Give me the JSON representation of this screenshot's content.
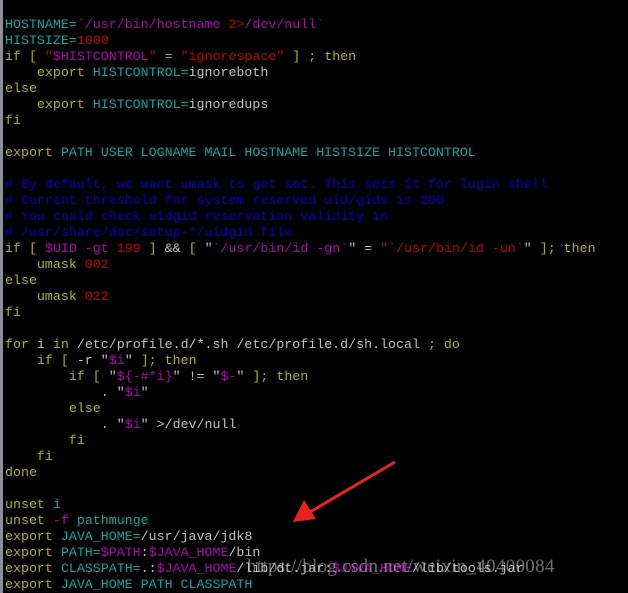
{
  "colors": {
    "k": "#b4b400",
    "c": "#00aaaa",
    "m": "#b000b0",
    "r": "#c00000",
    "b": "#0000c8",
    "w": "#c0c0c0",
    "arrow": "#e8231b"
  },
  "lines": [
    [
      [
        "HOSTNAME=",
        "c"
      ],
      [
        "`/usr/bin/hostname ",
        "m"
      ],
      [
        "2>",
        "r"
      ],
      [
        "/dev/null`",
        "m"
      ]
    ],
    [
      [
        "HISTSIZE=",
        "c"
      ],
      [
        "1000",
        "r"
      ]
    ],
    [
      [
        "if [ ",
        "k"
      ],
      [
        "\"",
        "r"
      ],
      [
        "$HISTCONTROL",
        "m"
      ],
      [
        "\"",
        "r"
      ],
      [
        " = ",
        "k"
      ],
      [
        "\"ignorespace\"",
        "r"
      ],
      [
        " ] ; then",
        "k"
      ]
    ],
    [
      [
        "    export ",
        "k"
      ],
      [
        "HISTCONTROL=",
        "c"
      ],
      [
        "ignoreboth",
        "w"
      ]
    ],
    [
      [
        "else",
        "k"
      ]
    ],
    [
      [
        "    export ",
        "k"
      ],
      [
        "HISTCONTROL=",
        "c"
      ],
      [
        "ignoredups",
        "w"
      ]
    ],
    [
      [
        "fi",
        "k"
      ]
    ],
    [],
    [
      [
        "export ",
        "k"
      ],
      [
        "PATH USER LOGNAME MAIL HOSTNAME HISTSIZE HISTCONTROL",
        "c"
      ]
    ],
    [],
    [
      [
        "# By default, we want umask to get set. This sets it for login shell",
        "b"
      ]
    ],
    [
      [
        "# Current threshold for system reserved uid/gids is 200",
        "b"
      ]
    ],
    [
      [
        "# You could check uidgid reservation validity in",
        "b"
      ]
    ],
    [
      [
        "# /usr/share/doc/setup-*/uidgid file",
        "b"
      ]
    ],
    [
      [
        "if [ ",
        "k"
      ],
      [
        "$UID -gt ",
        "m"
      ],
      [
        "199",
        "r"
      ],
      [
        " ] ",
        "k"
      ],
      [
        "&& ",
        "w"
      ],
      [
        "[ ",
        "k"
      ],
      [
        "\"",
        "w"
      ],
      [
        "`/usr/bin/id -gn`",
        "m"
      ],
      [
        "\" = ",
        "w"
      ],
      [
        "\"`/usr/bin/id -un`",
        "r"
      ],
      [
        "\"",
        "w"
      ],
      [
        " ]; then",
        "k"
      ]
    ],
    [
      [
        "    umask ",
        "k"
      ],
      [
        "002",
        "r"
      ]
    ],
    [
      [
        "else",
        "k"
      ]
    ],
    [
      [
        "    umask ",
        "k"
      ],
      [
        "022",
        "r"
      ]
    ],
    [
      [
        "fi",
        "k"
      ]
    ],
    [],
    [
      [
        "for ",
        "k"
      ],
      [
        "i ",
        "w"
      ],
      [
        "in ",
        "k"
      ],
      [
        "/etc/profile.d/*.sh /etc/profile.d/sh.local ",
        "w"
      ],
      [
        "; do",
        "k"
      ]
    ],
    [
      [
        "    if [ ",
        "k"
      ],
      [
        "-r ",
        "w"
      ],
      [
        "\"",
        "w"
      ],
      [
        "$i",
        "m"
      ],
      [
        "\"",
        "w"
      ],
      [
        " ]; then",
        "k"
      ]
    ],
    [
      [
        "        if [ ",
        "k"
      ],
      [
        "\"",
        "w"
      ],
      [
        "${-#*i}",
        "m"
      ],
      [
        "\" != \"",
        "w"
      ],
      [
        "$-",
        "m"
      ],
      [
        "\"",
        "w"
      ],
      [
        " ]; then",
        "k"
      ]
    ],
    [
      [
        "            . ",
        "w"
      ],
      [
        "\"",
        "w"
      ],
      [
        "$i",
        "m"
      ],
      [
        "\"",
        "w"
      ]
    ],
    [
      [
        "        else",
        "k"
      ]
    ],
    [
      [
        "            . ",
        "w"
      ],
      [
        "\"",
        "w"
      ],
      [
        "$i",
        "m"
      ],
      [
        "\" >/dev/null",
        "w"
      ]
    ],
    [
      [
        "        fi",
        "k"
      ]
    ],
    [
      [
        "    fi",
        "k"
      ]
    ],
    [
      [
        "done",
        "k"
      ]
    ],
    [],
    [
      [
        "unset ",
        "k"
      ],
      [
        "i",
        "c"
      ]
    ],
    [
      [
        "unset ",
        "k"
      ],
      [
        "-f ",
        "m"
      ],
      [
        "pathmunge",
        "c"
      ]
    ],
    [
      [
        "export ",
        "k"
      ],
      [
        "JAVA_HOME=",
        "c"
      ],
      [
        "/usr/java/jdk8",
        "w"
      ]
    ],
    [
      [
        "export ",
        "k"
      ],
      [
        "PATH=",
        "c"
      ],
      [
        "$PATH",
        "m"
      ],
      [
        ":",
        "w"
      ],
      [
        "$JAVA_HOME",
        "m"
      ],
      [
        "/bin",
        "w"
      ]
    ],
    [
      [
        "export ",
        "k"
      ],
      [
        "CLASSPATH=",
        "c"
      ],
      [
        ".:",
        "w"
      ],
      [
        "$JAVA_HOME",
        "m"
      ],
      [
        "/lib/dt.jar:",
        "w"
      ],
      [
        "$JAVA_HOME",
        "m"
      ],
      [
        "/lib/tools.jar",
        "w"
      ]
    ],
    [
      [
        "export ",
        "k"
      ],
      [
        "JAVA_HOME PATH CLASSPATH",
        "c"
      ]
    ]
  ],
  "watermark": "https://blog.csdn.net/weixin_40400084"
}
